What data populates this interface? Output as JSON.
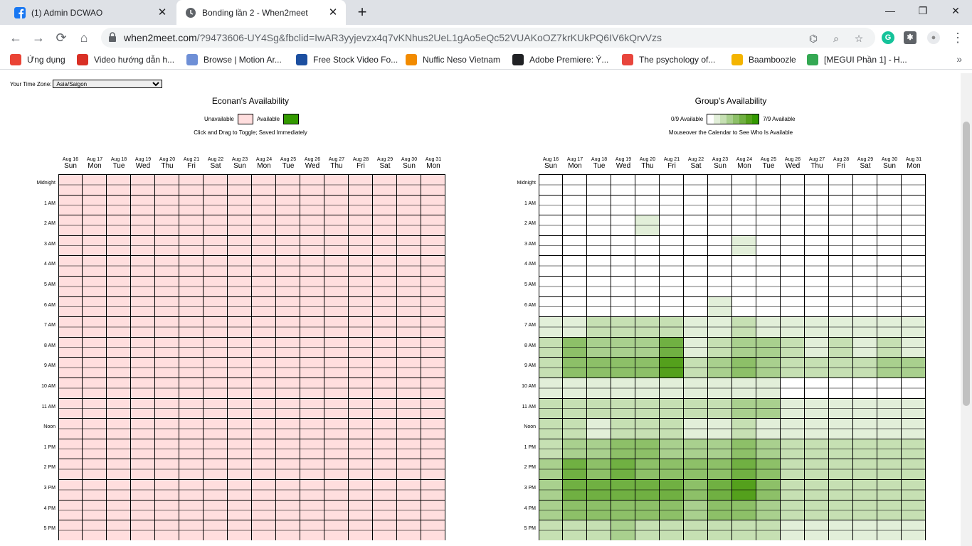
{
  "browser": {
    "tabs": [
      {
        "title": "(1) Admin DCWAO",
        "icon": "facebook-icon"
      },
      {
        "title": "Bonding lần 2 - When2meet",
        "icon": "clock-icon"
      }
    ],
    "url_host": "when2meet.com",
    "url_rest": "/?9473606-UY4Sg&fbclid=IwAR3yyjevzx4q7vKNhus2UeL1gAo5eQc52VUAKoOZ7krKUkPQ6IV6kQrvVzs",
    "bookmarks": [
      {
        "label": "Ứng dụng",
        "icon": "apps-icon",
        "color": "#ea4335"
      },
      {
        "label": "Video hướng dẫn h...",
        "icon": "video-icon",
        "color": "#d93025"
      },
      {
        "label": "Browse | Motion Ar...",
        "icon": "motion-array-icon",
        "color": "#6e8fd6"
      },
      {
        "label": "Free Stock Video Fo...",
        "icon": "v-icon",
        "color": "#1c4fa0"
      },
      {
        "label": "Nuffic Neso Vietnam",
        "icon": "nuffic-icon",
        "color": "#f28b00"
      },
      {
        "label": "Adobe Premiere: Ý...",
        "icon": "globe-icon",
        "color": "#202124"
      },
      {
        "label": "The psychology of...",
        "icon": "99d-icon",
        "color": "#e8453c"
      },
      {
        "label": "Baamboozle",
        "icon": "baamboozle-icon",
        "color": "#f4b400"
      },
      {
        "label": "[MEGUI Phần 1] - H...",
        "icon": "megui-icon",
        "color": "#34a853"
      }
    ]
  },
  "page": {
    "timezone_label": "Your Time Zone:",
    "timezone_value": "Asia/Saigon",
    "left": {
      "title": "Econan's Availability",
      "legend_unavailable": "Unavailable",
      "legend_available": "Available",
      "hint": "Click and Drag to Toggle; Saved Immediately"
    },
    "right": {
      "title": "Group's Availability",
      "legend_min": "0/9 Available",
      "legend_max": "7/9 Available",
      "hint": "Mouseover the Calendar to See Who Is Available"
    },
    "days": [
      {
        "date": "Aug 16",
        "day": "Sun"
      },
      {
        "date": "Aug 17",
        "day": "Mon"
      },
      {
        "date": "Aug 18",
        "day": "Tue"
      },
      {
        "date": "Aug 19",
        "day": "Wed"
      },
      {
        "date": "Aug 20",
        "day": "Thu"
      },
      {
        "date": "Aug 21",
        "day": "Fri"
      },
      {
        "date": "Aug 22",
        "day": "Sat"
      },
      {
        "date": "Aug 23",
        "day": "Sun"
      },
      {
        "date": "Aug 24",
        "day": "Mon"
      },
      {
        "date": "Aug 25",
        "day": "Tue"
      },
      {
        "date": "Aug 26",
        "day": "Wed"
      },
      {
        "date": "Aug 27",
        "day": "Thu"
      },
      {
        "date": "Aug 28",
        "day": "Fri"
      },
      {
        "date": "Aug 29",
        "day": "Sat"
      },
      {
        "date": "Aug 30",
        "day": "Sun"
      },
      {
        "date": "Aug 31",
        "day": "Mon"
      }
    ],
    "hours": [
      "Midnight",
      "1 AM",
      "2 AM",
      "3 AM",
      "4 AM",
      "5 AM",
      "6 AM",
      "7 AM",
      "8 AM",
      "9 AM",
      "10 AM",
      "11 AM",
      "Noon",
      "1 PM",
      "2 PM",
      "3 PM",
      "4 PM",
      "5 PM"
    ],
    "colors": {
      "unavailable": "#ffdede",
      "available": "#339900",
      "levels": [
        "#ffffff",
        "#e2efd9",
        "#c6e0b3",
        "#a9d08e",
        "#8dc068",
        "#70b042",
        "#54a01c",
        "#339900"
      ]
    },
    "group_levels": [
      [
        0,
        0,
        0,
        0,
        0,
        0,
        0,
        0,
        0,
        0,
        0,
        0,
        0,
        0,
        0,
        0
      ],
      [
        0,
        0,
        0,
        0,
        0,
        0,
        0,
        0,
        0,
        0,
        0,
        0,
        0,
        0,
        0,
        0
      ],
      [
        0,
        0,
        0,
        0,
        1,
        0,
        0,
        0,
        0,
        0,
        0,
        0,
        0,
        0,
        0,
        0
      ],
      [
        0,
        0,
        0,
        0,
        0,
        0,
        0,
        0,
        1,
        0,
        0,
        0,
        0,
        0,
        0,
        0
      ],
      [
        0,
        0,
        0,
        0,
        0,
        0,
        0,
        0,
        0,
        0,
        0,
        0,
        0,
        0,
        0,
        0
      ],
      [
        0,
        0,
        0,
        0,
        0,
        0,
        0,
        0,
        0,
        0,
        0,
        0,
        0,
        0,
        0,
        0
      ],
      [
        0,
        0,
        0,
        0,
        0,
        0,
        0,
        1,
        0,
        0,
        0,
        0,
        0,
        0,
        0,
        0
      ],
      [
        1,
        1,
        2,
        2,
        2,
        2,
        1,
        1,
        2,
        1,
        1,
        1,
        1,
        1,
        1,
        1
      ],
      [
        2,
        4,
        3,
        3,
        3,
        5,
        1,
        2,
        3,
        3,
        2,
        1,
        2,
        1,
        2,
        1
      ],
      [
        2,
        4,
        4,
        4,
        4,
        6,
        2,
        3,
        4,
        3,
        2,
        2,
        2,
        2,
        3,
        3
      ],
      [
        1,
        1,
        1,
        1,
        1,
        1,
        1,
        1,
        1,
        1,
        0,
        0,
        0,
        0,
        0,
        0
      ],
      [
        2,
        2,
        2,
        2,
        2,
        2,
        2,
        2,
        3,
        3,
        1,
        1,
        1,
        1,
        1,
        1
      ],
      [
        2,
        2,
        1,
        2,
        2,
        2,
        1,
        1,
        2,
        1,
        1,
        1,
        1,
        1,
        1,
        1
      ],
      [
        2,
        3,
        3,
        4,
        4,
        3,
        3,
        3,
        4,
        3,
        2,
        2,
        2,
        2,
        2,
        2
      ],
      [
        3,
        5,
        4,
        5,
        4,
        4,
        4,
        4,
        5,
        4,
        2,
        2,
        2,
        2,
        2,
        2
      ],
      [
        3,
        5,
        5,
        5,
        5,
        5,
        4,
        5,
        6,
        4,
        2,
        2,
        2,
        2,
        2,
        2
      ],
      [
        3,
        4,
        4,
        4,
        4,
        4,
        3,
        4,
        4,
        3,
        2,
        2,
        2,
        2,
        2,
        2
      ],
      [
        2,
        2,
        2,
        3,
        2,
        2,
        2,
        2,
        2,
        2,
        1,
        1,
        1,
        1,
        1,
        1
      ]
    ]
  }
}
